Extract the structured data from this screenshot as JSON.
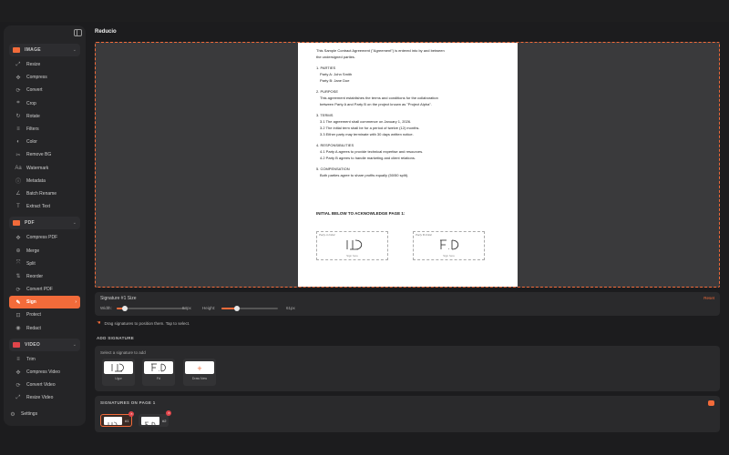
{
  "app": {
    "title": "Reducio"
  },
  "sidebar": {
    "sections": [
      {
        "label": "IMAGE",
        "color": "#f26b3a",
        "items": [
          "Resize",
          "Compress",
          "Convert",
          "Crop",
          "Rotate",
          "Filters",
          "Color",
          "Remove BG",
          "Watermark",
          "Metadata",
          "Batch Rename",
          "Extract Text"
        ]
      },
      {
        "label": "PDF",
        "color": "#f26b3a",
        "items": [
          "Compress PDF",
          "Merge",
          "Split",
          "Reorder",
          "Convert PDF",
          "Sign",
          "Protect",
          "Redact"
        ]
      },
      {
        "label": "VIDEO",
        "color": "#e0454a",
        "items": [
          "Trim",
          "Compress Video",
          "Convert Video",
          "Resize Video"
        ]
      }
    ],
    "active_item": "Sign",
    "settings_label": "Settings"
  },
  "document": {
    "intro": [
      "This Sample Contract Agreement (\"Agreement\") is entered into by and between",
      "the undersigned parties."
    ],
    "parties": [
      "1. PARTIES",
      "Party A: John Smith",
      "Party B: Jane Doe"
    ],
    "purpose": [
      "2. PURPOSE",
      "This agreement establishes the terms and conditions for the collaboration",
      "between Party A and Party B on the project known as \"Project Alpha\"."
    ],
    "terms": [
      "3. TERMS",
      "3.1 The agreement shall commence on January 1, 2026.",
      "3.2 The initial term shall be for a period of twelve (12) months.",
      "3.3 Either party may terminate with 30 days written notice."
    ],
    "responsibilities": [
      "4. RESPONSIBILITIES",
      "4.1 Party A agrees to provide technical expertise and resources.",
      "4.2 Party B agrees to handle marketing and client relations."
    ],
    "compensation": [
      "5. COMPENSATION",
      "Both parties agree to share profits equally (50/50 split)."
    ],
    "initial_heading": "INITIAL BELOW TO ACKNOWLEDGE PAGE 1:",
    "sig_boxes": [
      {
        "label": "Party A Initial",
        "hint": "Sign here"
      },
      {
        "label": "Party B Initial",
        "hint": "Sign here"
      }
    ]
  },
  "size_panel": {
    "title": "Signature #1 Size",
    "reset": "Reset",
    "width_label": "Width:",
    "width_value": "84px",
    "width_fraction": 0.12,
    "height_label": "Height:",
    "height_value": "61px",
    "height_fraction": 0.28
  },
  "hint": "Drag signatures to position them. Tap to select.",
  "add_signature": {
    "title": "ADD SIGNATURE",
    "subtitle": "Select a signature to add",
    "cards": [
      {
        "caption": "Ugur"
      },
      {
        "caption": "Fd"
      },
      {
        "caption": "Draw New"
      }
    ],
    "plus_icon": "+"
  },
  "on_page": {
    "title": "SIGNATURES ON PAGE 1",
    "chips": [
      {
        "num": "#1",
        "remove": "×"
      },
      {
        "num": "#2",
        "remove": "×"
      }
    ]
  },
  "colors": {
    "accent": "#f26b3a",
    "danger": "#e0454a"
  }
}
